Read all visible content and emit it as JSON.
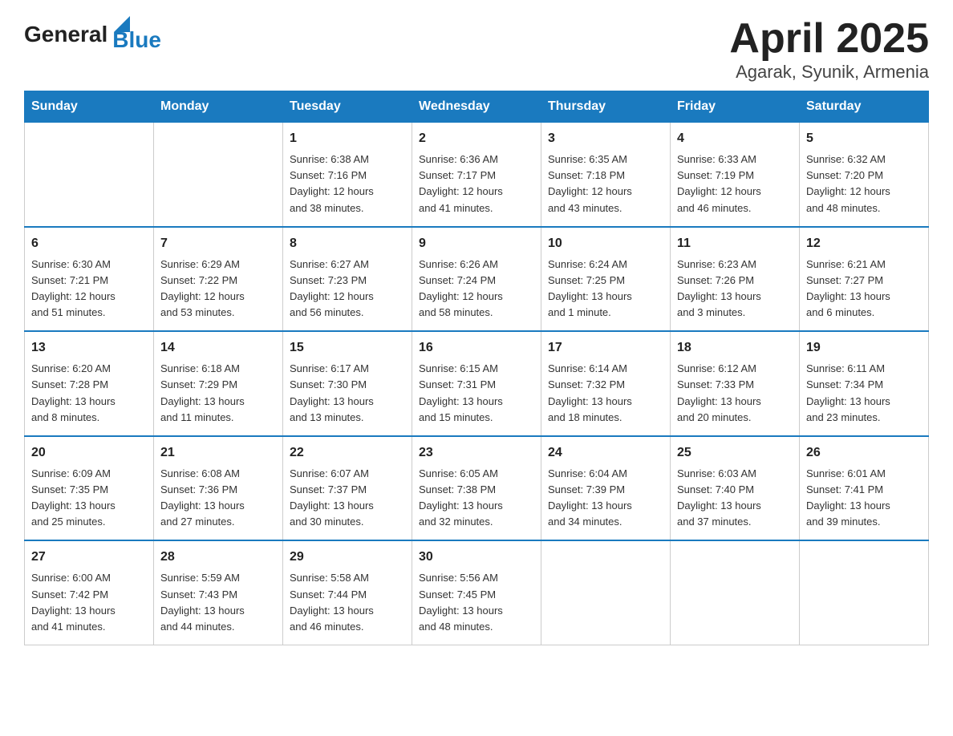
{
  "header": {
    "logo": {
      "general": "General",
      "blue": "Blue"
    },
    "title": "April 2025",
    "subtitle": "Agarak, Syunik, Armenia"
  },
  "calendar": {
    "days_of_week": [
      "Sunday",
      "Monday",
      "Tuesday",
      "Wednesday",
      "Thursday",
      "Friday",
      "Saturday"
    ],
    "weeks": [
      [
        {
          "day": "",
          "info": ""
        },
        {
          "day": "",
          "info": ""
        },
        {
          "day": "1",
          "info": "Sunrise: 6:38 AM\nSunset: 7:16 PM\nDaylight: 12 hours\nand 38 minutes."
        },
        {
          "day": "2",
          "info": "Sunrise: 6:36 AM\nSunset: 7:17 PM\nDaylight: 12 hours\nand 41 minutes."
        },
        {
          "day": "3",
          "info": "Sunrise: 6:35 AM\nSunset: 7:18 PM\nDaylight: 12 hours\nand 43 minutes."
        },
        {
          "day": "4",
          "info": "Sunrise: 6:33 AM\nSunset: 7:19 PM\nDaylight: 12 hours\nand 46 minutes."
        },
        {
          "day": "5",
          "info": "Sunrise: 6:32 AM\nSunset: 7:20 PM\nDaylight: 12 hours\nand 48 minutes."
        }
      ],
      [
        {
          "day": "6",
          "info": "Sunrise: 6:30 AM\nSunset: 7:21 PM\nDaylight: 12 hours\nand 51 minutes."
        },
        {
          "day": "7",
          "info": "Sunrise: 6:29 AM\nSunset: 7:22 PM\nDaylight: 12 hours\nand 53 minutes."
        },
        {
          "day": "8",
          "info": "Sunrise: 6:27 AM\nSunset: 7:23 PM\nDaylight: 12 hours\nand 56 minutes."
        },
        {
          "day": "9",
          "info": "Sunrise: 6:26 AM\nSunset: 7:24 PM\nDaylight: 12 hours\nand 58 minutes."
        },
        {
          "day": "10",
          "info": "Sunrise: 6:24 AM\nSunset: 7:25 PM\nDaylight: 13 hours\nand 1 minute."
        },
        {
          "day": "11",
          "info": "Sunrise: 6:23 AM\nSunset: 7:26 PM\nDaylight: 13 hours\nand 3 minutes."
        },
        {
          "day": "12",
          "info": "Sunrise: 6:21 AM\nSunset: 7:27 PM\nDaylight: 13 hours\nand 6 minutes."
        }
      ],
      [
        {
          "day": "13",
          "info": "Sunrise: 6:20 AM\nSunset: 7:28 PM\nDaylight: 13 hours\nand 8 minutes."
        },
        {
          "day": "14",
          "info": "Sunrise: 6:18 AM\nSunset: 7:29 PM\nDaylight: 13 hours\nand 11 minutes."
        },
        {
          "day": "15",
          "info": "Sunrise: 6:17 AM\nSunset: 7:30 PM\nDaylight: 13 hours\nand 13 minutes."
        },
        {
          "day": "16",
          "info": "Sunrise: 6:15 AM\nSunset: 7:31 PM\nDaylight: 13 hours\nand 15 minutes."
        },
        {
          "day": "17",
          "info": "Sunrise: 6:14 AM\nSunset: 7:32 PM\nDaylight: 13 hours\nand 18 minutes."
        },
        {
          "day": "18",
          "info": "Sunrise: 6:12 AM\nSunset: 7:33 PM\nDaylight: 13 hours\nand 20 minutes."
        },
        {
          "day": "19",
          "info": "Sunrise: 6:11 AM\nSunset: 7:34 PM\nDaylight: 13 hours\nand 23 minutes."
        }
      ],
      [
        {
          "day": "20",
          "info": "Sunrise: 6:09 AM\nSunset: 7:35 PM\nDaylight: 13 hours\nand 25 minutes."
        },
        {
          "day": "21",
          "info": "Sunrise: 6:08 AM\nSunset: 7:36 PM\nDaylight: 13 hours\nand 27 minutes."
        },
        {
          "day": "22",
          "info": "Sunrise: 6:07 AM\nSunset: 7:37 PM\nDaylight: 13 hours\nand 30 minutes."
        },
        {
          "day": "23",
          "info": "Sunrise: 6:05 AM\nSunset: 7:38 PM\nDaylight: 13 hours\nand 32 minutes."
        },
        {
          "day": "24",
          "info": "Sunrise: 6:04 AM\nSunset: 7:39 PM\nDaylight: 13 hours\nand 34 minutes."
        },
        {
          "day": "25",
          "info": "Sunrise: 6:03 AM\nSunset: 7:40 PM\nDaylight: 13 hours\nand 37 minutes."
        },
        {
          "day": "26",
          "info": "Sunrise: 6:01 AM\nSunset: 7:41 PM\nDaylight: 13 hours\nand 39 minutes."
        }
      ],
      [
        {
          "day": "27",
          "info": "Sunrise: 6:00 AM\nSunset: 7:42 PM\nDaylight: 13 hours\nand 41 minutes."
        },
        {
          "day": "28",
          "info": "Sunrise: 5:59 AM\nSunset: 7:43 PM\nDaylight: 13 hours\nand 44 minutes."
        },
        {
          "day": "29",
          "info": "Sunrise: 5:58 AM\nSunset: 7:44 PM\nDaylight: 13 hours\nand 46 minutes."
        },
        {
          "day": "30",
          "info": "Sunrise: 5:56 AM\nSunset: 7:45 PM\nDaylight: 13 hours\nand 48 minutes."
        },
        {
          "day": "",
          "info": ""
        },
        {
          "day": "",
          "info": ""
        },
        {
          "day": "",
          "info": ""
        }
      ]
    ]
  }
}
